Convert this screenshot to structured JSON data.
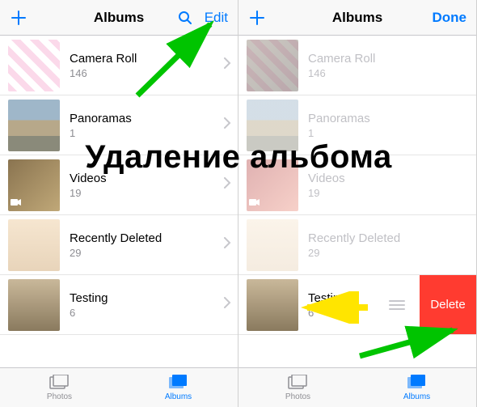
{
  "overlay_title": "Удаление альбома",
  "left": {
    "nav": {
      "title": "Albums",
      "edit": "Edit"
    },
    "albums": [
      {
        "title": "Camera Roll",
        "count": "146"
      },
      {
        "title": "Panoramas",
        "count": "1"
      },
      {
        "title": "Videos",
        "count": "19"
      },
      {
        "title": "Recently Deleted",
        "count": "29"
      },
      {
        "title": "Testing",
        "count": "6"
      }
    ],
    "tabs": {
      "photos": "Photos",
      "albums": "Albums"
    }
  },
  "right": {
    "nav": {
      "title": "Albums",
      "done": "Done"
    },
    "albums": [
      {
        "title": "Camera Roll",
        "count": "146"
      },
      {
        "title": "Panoramas",
        "count": "1"
      },
      {
        "title": "Videos",
        "count": "19"
      },
      {
        "title": "Recently Deleted",
        "count": "29"
      },
      {
        "title": "Testing",
        "count": "6"
      }
    ],
    "delete_label": "Delete",
    "tabs": {
      "photos": "Photos",
      "albums": "Albums"
    }
  }
}
